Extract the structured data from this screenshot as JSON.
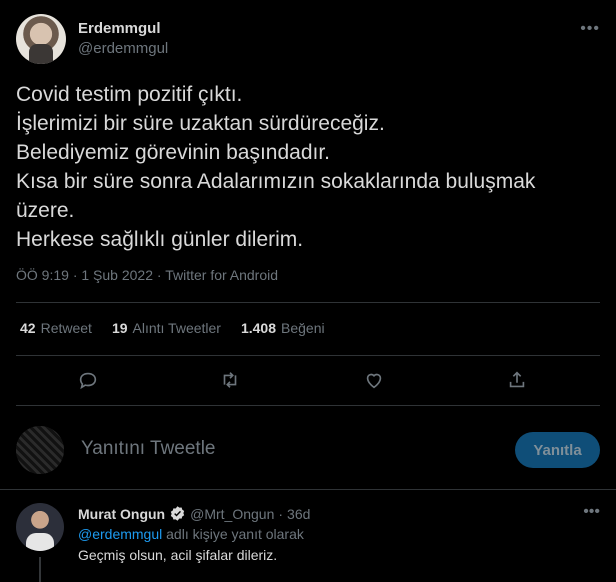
{
  "tweet": {
    "author": {
      "name": "Erdemmgul",
      "handle": "@erdemmgul"
    },
    "more_icon": "more-horizontal-icon",
    "text_lines": [
      "Covid testim pozitif çıktı.",
      "İşlerimizi bir süre uzaktan sürdüreceğiz.",
      "Belediyemiz görevinin başındadır.",
      "Kısa bir süre sonra Adalarımızın sokaklarında buluşmak",
      "üzere.",
      "Herkese sağlıklı günler dilerim."
    ],
    "time": "ÖÖ 9:19",
    "sep": "·",
    "date": "1 Şub 2022",
    "source": "Twitter for Android"
  },
  "stats": {
    "retweets": {
      "count": "42",
      "label": "Retweet"
    },
    "quotes": {
      "count": "19",
      "label": "Alıntı Tweetler"
    },
    "likes": {
      "count": "1.408",
      "label": "Beğeni"
    }
  },
  "actions": [
    "reply-icon",
    "retweet-icon",
    "like-icon",
    "share-icon"
  ],
  "compose": {
    "placeholder": "Yanıtını Tweetle",
    "button_label": "Yanıtla"
  },
  "reply": {
    "name": "Murat Ongun",
    "handle": "@Mrt_Ongun",
    "dot": "·",
    "time": "36d",
    "replying_mention": "@erdemmgul",
    "replying_suffix": " adlı kişiye yanıt olarak",
    "text": "Geçmiş olsun, acil şifalar dileriz."
  },
  "colors": {
    "background": "#000000",
    "text": "#d9d9d9",
    "muted": "#6e767d",
    "accent": "#1d9bf0",
    "divider": "#2f3336"
  }
}
